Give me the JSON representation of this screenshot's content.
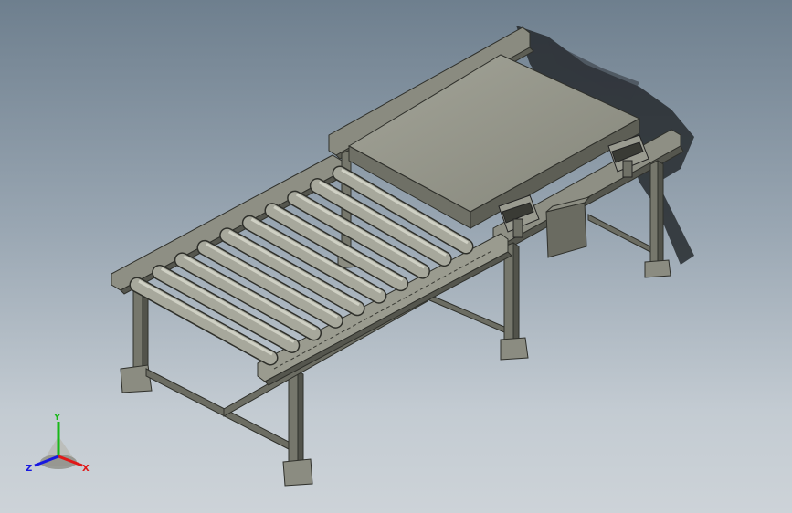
{
  "triad": {
    "y_label": "Y",
    "x_label": "X",
    "z_label": "Z",
    "colors": {
      "x": "#e01818",
      "y": "#18b818",
      "z": "#1818e0"
    }
  },
  "palette": {
    "steel_light": "#9c9c90",
    "steel_mid": "#7d7e73",
    "steel_dark": "#4a4b44",
    "roller": "#a7a89c",
    "tabletop": "#94958a",
    "shadow": "#2a2d31"
  }
}
